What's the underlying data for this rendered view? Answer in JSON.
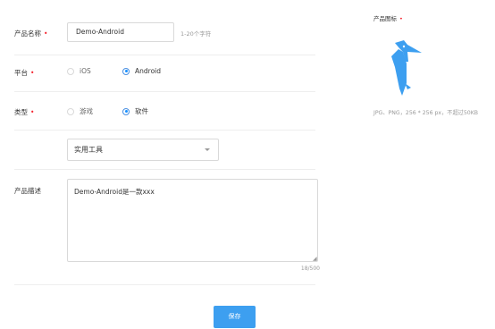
{
  "form": {
    "name": {
      "label": "产品名称",
      "required_mark": "•",
      "value": "Demo-Android",
      "hint": "1-20个字符"
    },
    "platform": {
      "label": "平台",
      "required_mark": "•",
      "options": [
        {
          "label": "iOS",
          "checked": false
        },
        {
          "label": "Android",
          "checked": true
        }
      ]
    },
    "type": {
      "label": "类型",
      "required_mark": "•",
      "options": [
        {
          "label": "游戏",
          "checked": false
        },
        {
          "label": "软件",
          "checked": true
        }
      ]
    },
    "category": {
      "selected": "实用工具",
      "caret_icon": "chevron-down-icon"
    },
    "description": {
      "label": "产品描述",
      "value": "Demo-Android是一款xxx",
      "counter": "18/500"
    },
    "save_label": "保存"
  },
  "product_icon": {
    "label": "产品图标",
    "required_mark": "•",
    "icon_name": "woodpecker-logo-icon",
    "icon_color": "#3d9ff0",
    "hint": "JPG、PNG，256 * 256 px，不超过50KB"
  },
  "colors": {
    "accent": "#3d9ff0",
    "required": "#f5222d"
  }
}
